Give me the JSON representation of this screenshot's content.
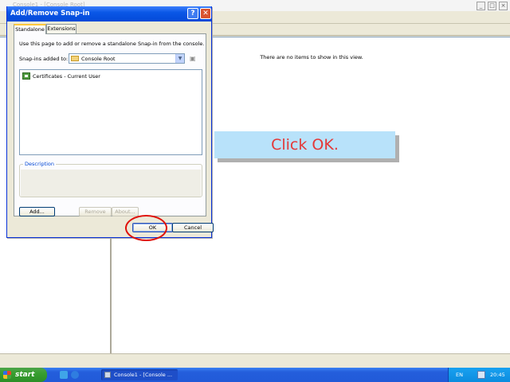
{
  "background_window": {
    "title": "Console1 - [Console Root]",
    "empty_list_message": "There are no items to show in this view."
  },
  "dialog": {
    "title": "Add/Remove Snap-in",
    "help_glyph": "?",
    "close_glyph": "✕",
    "tabs": [
      {
        "label": "Standalone",
        "selected": true
      },
      {
        "label": "Extensions",
        "selected": false
      }
    ],
    "instruction": "Use this page to add or remove a standalone Snap-in from the console.",
    "snapins_added_to_label": "Snap-ins added to:",
    "snapins_added_to_value": "Console Root",
    "snapin_list": [
      {
        "label": "Certificates - Current User",
        "icon": "certificates-icon"
      }
    ],
    "description_label": "Description",
    "buttons": {
      "add": "Add...",
      "remove": "Remove",
      "about": "About...",
      "ok": "OK",
      "cancel": "Cancel"
    }
  },
  "annotation": {
    "callout_text": "Click OK.",
    "callout_color": "#b8e2fa",
    "callout_text_color": "#e43838",
    "highlight_color": "#e0100a"
  },
  "taskbar": {
    "start_label": "start",
    "task_label": "Console1 - [Console ...",
    "language": "EN",
    "clock": "20:45"
  }
}
